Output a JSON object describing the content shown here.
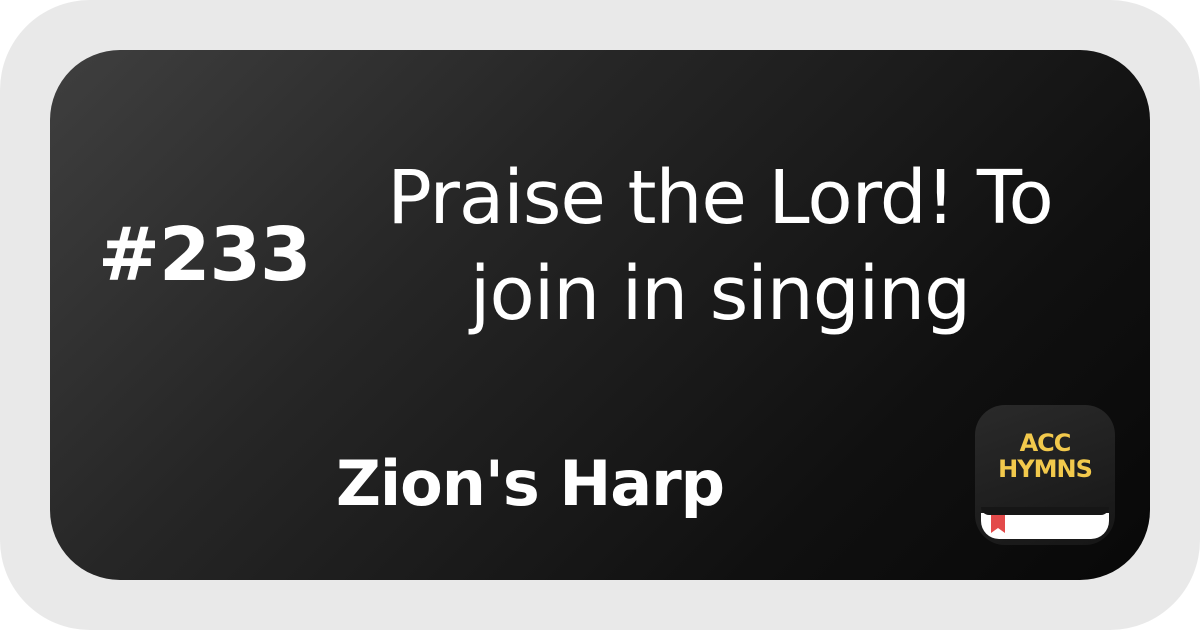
{
  "hymn": {
    "number": "#233",
    "title_line1": "Praise the Lord! To",
    "title_line2": "join in singing",
    "book": "Zion's Harp"
  },
  "app_icon": {
    "line1": "ACC",
    "line2": "HYMNS",
    "icon": "book-bookmark-icon",
    "text_color": "#f2c94c",
    "ribbon_color": "#e34a4a"
  },
  "colors": {
    "frame": "#e9e9e9",
    "card_dark": "#0a0a0a",
    "card_light": "#3f3f3f",
    "text": "#ffffff"
  }
}
